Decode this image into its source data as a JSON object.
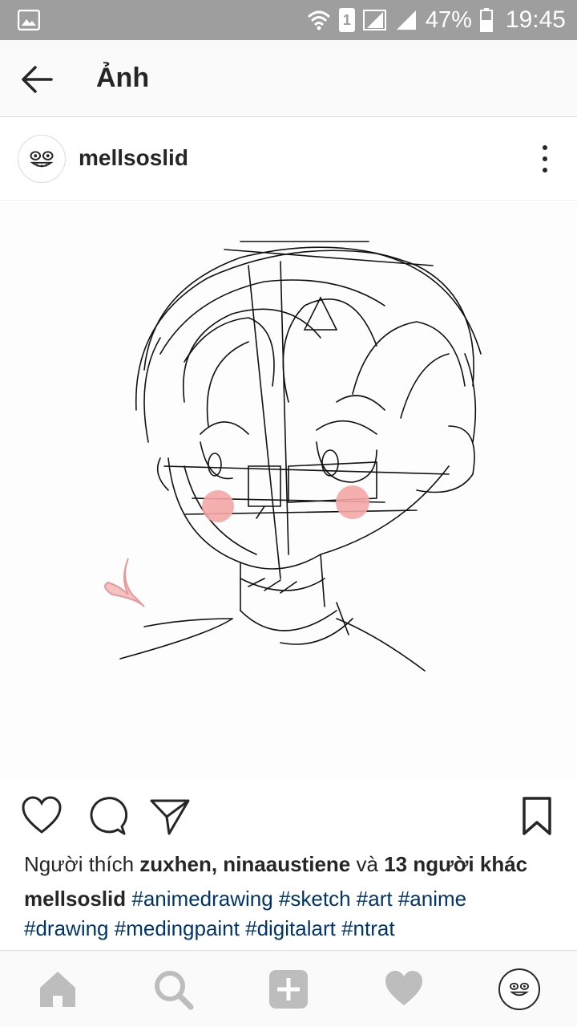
{
  "status_bar": {
    "battery_percent": "47%",
    "time": "19:45",
    "sim_label": "1",
    "icons": [
      "gallery-icon",
      "wifi-icon",
      "sim-icon",
      "signal-icon",
      "battery-icon"
    ]
  },
  "app_bar": {
    "title": "Ảnh",
    "back_icon": "arrow-left-icon"
  },
  "post": {
    "username": "mellsoslid",
    "more_icon": "more-vertical-icon",
    "image_icon": "anime-sketch-drawing",
    "actions": [
      "heart-icon",
      "comment-icon",
      "share-icon",
      "bookmark-icon"
    ],
    "likes": {
      "prefix": "Người thích",
      "users": "zuxhen, ninaaustiene",
      "connector": "và",
      "others": "13 người khác"
    },
    "caption": {
      "author": "mellsoslid",
      "hashtags": [
        "#animedrawing",
        "#sketch",
        "#art",
        "#anime",
        "#drawing",
        "#medingpaint",
        "#digitalart",
        "#ntrat"
      ]
    }
  },
  "bottom_nav": {
    "items": [
      "home-icon",
      "search-icon",
      "add-icon",
      "activity-heart-icon",
      "profile-avatar-icon"
    ]
  },
  "colors": {
    "status_bar": "#9e9e9e",
    "link": "#003569",
    "text": "#262626",
    "blush": "#f4a6a6"
  }
}
